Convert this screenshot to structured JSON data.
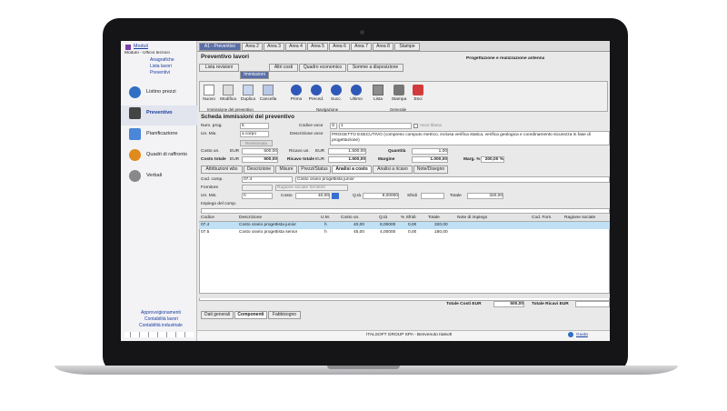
{
  "sidebar": {
    "module_title": "Moduli",
    "module_sub": "Modulo - Ufficio tecnico",
    "links": [
      "Anagrafiche",
      "Lista lavori",
      "Preventivi"
    ],
    "items": [
      {
        "label": "Listino prezzi",
        "icon": "euro-icon",
        "color": "#2f6fc4"
      },
      {
        "label": "Preventivo",
        "icon": "calculator-icon",
        "color": "#444444"
      },
      {
        "label": "Pianificazione",
        "icon": "calendar-icon",
        "color": "#4a86d9"
      },
      {
        "label": "Quadri di raffronto",
        "icon": "shapes-icon",
        "color": "#e08a1e"
      },
      {
        "label": "Verbali",
        "icon": "pen-icon",
        "color": "#666666"
      }
    ],
    "bottom_links": [
      "Approvvigionamenti",
      "Contabilità lavori",
      "Contabilità industriale"
    ]
  },
  "top_tabs": [
    "A1 - Preventivo",
    "Area 2",
    "Area 3",
    "Area 4",
    "Area 5",
    "Area 6",
    "Area 7",
    "Area 8",
    "Stampe"
  ],
  "header": {
    "title": "Preventivo lavori",
    "subtitle": "Progettazione e realizzazione antenna"
  },
  "sub_tabs": [
    "Lista revisioni",
    "Altri costi",
    "Quadro economico",
    "Somme a disposizione"
  ],
  "active_sub_tab": "Immissioni",
  "toolbar": {
    "buttons": [
      "Nuovo",
      "Modifica",
      "Duplica",
      "Cancella",
      "Primo",
      "Preced.",
      "Succ.",
      "Ultimo",
      "Lista",
      "Stampa",
      "Esci"
    ],
    "groups": [
      "Immissione del preventivo",
      "Navigazione",
      "Generale"
    ]
  },
  "form": {
    "title": "Scheda immissioni del preventivo",
    "num_prog_label": "Num. prog.",
    "num_prog": "5",
    "un_mis_label": "Un. Mis.",
    "un_mis": "a corpo",
    "revisionata": "Revisionata",
    "codice_voce_label": "Codice voce",
    "codice_voce_a": "S",
    "codice_voce_b": "1",
    "voce_libera": "Voce libera",
    "descrizione_voce_label": "Descrizione voce",
    "descrizione_voce": "PROGETTO ESECUTIVO (compreso computo metrico, inclusa verifica statica, verifica geologica e coordinamento sicurezza in fase di progettazione)",
    "costo_un_label": "Costo un.",
    "costo_un": "500,00",
    "ricavo_un_label": "Ricavo un.",
    "ricavo_un": "1.500,00",
    "quantita_label": "Quantità",
    "quantita": "1,00",
    "costo_totale_label": "Costo totale",
    "costo_totale": "500,00",
    "ricavo_totale_label": "Ricavo totale",
    "ricavo_totale": "1.500,00",
    "margine_label": "Margine",
    "margine": "1.000,00",
    "marg_label": "Marg. %",
    "marg": "200,00 %",
    "eur": "EUR"
  },
  "detail_tabs": [
    "Attribuzioni wbs",
    "Descrizione",
    "Misure",
    "Prezzi/Status",
    "Analisi a costo",
    "Analisi a ricavo",
    "Note/Disegno"
  ],
  "analysis": {
    "cod_comp_label": "Cod. comp.",
    "cod_comp": "07.4",
    "cod_comp_desc": "Costo orario progettista junior",
    "fornitore_label": "Fornitore",
    "ragione_sociale": "Ragione sociale fornitore",
    "un_mis_label": "Un. Mis.",
    "un_mis": "h",
    "costo_label": "Costo",
    "costo": "40,00",
    "qta_label": "Q.tà",
    "qta": "8,00000",
    "sfridi_label": "Sfridi",
    "totale_label": "Totale",
    "totale": "320,00",
    "impiego_label": "Impiego del comp."
  },
  "table": {
    "headers": [
      "Codice",
      "Descrizione",
      "U.M.",
      "Costo un.",
      "Q.tà",
      "% Sfridi",
      "Totale",
      "Note di impiego",
      "Cod. Forn.",
      "Ragione sociale"
    ],
    "rows": [
      [
        "07.4",
        "Costo orario progettista junior",
        "h",
        "40,00",
        "8,00000",
        "0,00",
        "320,00"
      ],
      [
        "07.5",
        "Costo orario progettista senior",
        "h",
        "45,00",
        "4,00000",
        "0,00",
        "180,00"
      ]
    ],
    "totale_costi_label": "Totale Costi EUR",
    "totale_costi": "500,00",
    "totale_ricavi_label": "Totale Ricavi EUR"
  },
  "bottom_tabs": [
    "Dati generali",
    "Componenti",
    "Fabbisogno"
  ],
  "status": {
    "text": "ITALSOFT GROUP SPA - Benvenuto Italsoft",
    "guide": "Guida"
  }
}
